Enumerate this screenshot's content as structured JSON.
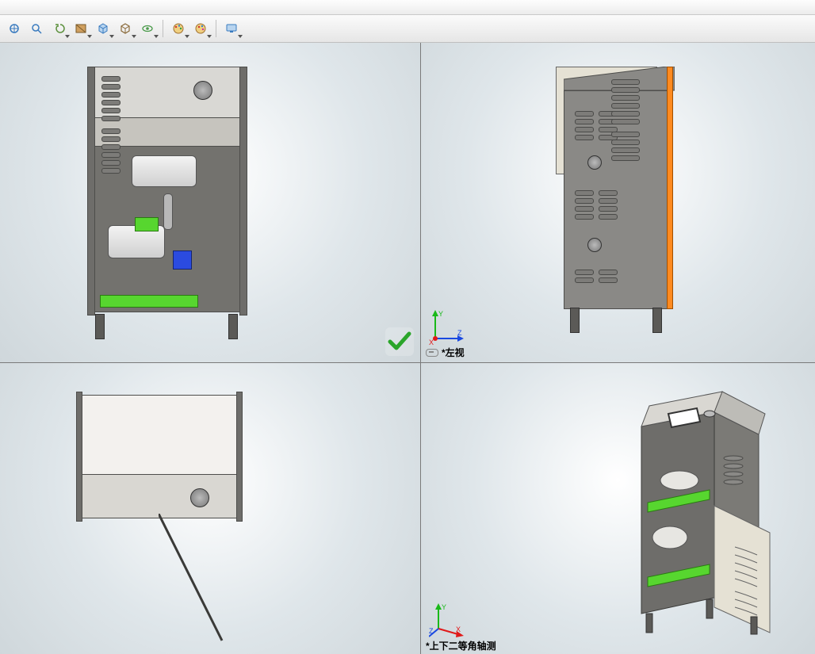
{
  "toolbar": {
    "items": [
      {
        "name": "zoom-to-fit-icon",
        "glyph": "✧"
      },
      {
        "name": "zoom-area-icon",
        "glyph": "🔍"
      },
      {
        "name": "previous-view-icon",
        "glyph": "↺"
      },
      {
        "name": "section-view-icon",
        "glyph": "▥"
      },
      {
        "name": "view-orientation-icon",
        "glyph": "◧"
      },
      {
        "name": "display-style-icon",
        "glyph": "▦"
      },
      {
        "name": "hide-show-icon",
        "glyph": "👁"
      },
      {
        "name": "edit-appearance-icon",
        "glyph": "🎨"
      },
      {
        "name": "apply-scene-icon",
        "glyph": "🎨"
      },
      {
        "name": "view-settings-icon",
        "glyph": "🖥"
      }
    ]
  },
  "viewports": {
    "vp2": {
      "label": "*左视"
    },
    "vp4": {
      "label": "*上下二等角轴测"
    }
  },
  "axes": {
    "x": "X",
    "y": "Y",
    "z": "Z"
  },
  "colors": {
    "x": "#e11919",
    "y": "#19b919",
    "z": "#1948e1",
    "panel": "#8a8986",
    "door": "#e5e1d4",
    "accent": "#ff8a1f",
    "green": "#57d62f"
  }
}
